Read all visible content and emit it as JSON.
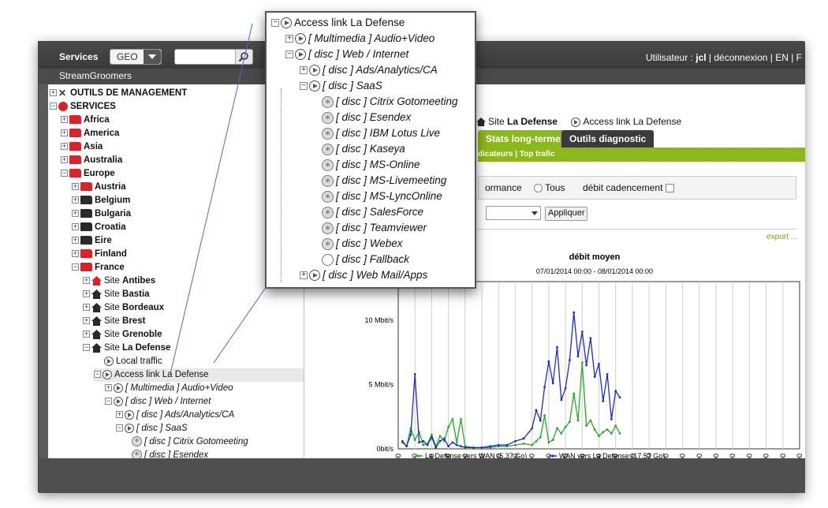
{
  "topbar": {
    "services_label": "Services",
    "geo_value": "GEO",
    "org_name": "StreamGroomers",
    "user_label": "Utilisateur : ",
    "user_name": "jcl",
    "user_links": " | déconnexion | EN | F"
  },
  "sidebar": {
    "items": [
      {
        "label": "OUTILS DE MANAGEMENT"
      },
      {
        "label": "SERVICES"
      },
      {
        "label": "Africa"
      },
      {
        "label": "America"
      },
      {
        "label": "Asia"
      },
      {
        "label": "Australia"
      },
      {
        "label": "Europe"
      },
      {
        "label": "Austria"
      },
      {
        "label": "Belgium"
      },
      {
        "label": "Bulgaria"
      },
      {
        "label": "Croatia"
      },
      {
        "label": "Eire"
      },
      {
        "label": "Finland"
      },
      {
        "label": "France"
      },
      {
        "prefix": "Site ",
        "label": "Antibes"
      },
      {
        "prefix": "Site ",
        "label": "Bastia"
      },
      {
        "prefix": "Site ",
        "label": "Bordeaux"
      },
      {
        "prefix": "Site ",
        "label": "Brest"
      },
      {
        "prefix": "Site ",
        "label": "Grenoble"
      },
      {
        "prefix": "Site ",
        "label": "La Defense"
      },
      {
        "label": "Local traffic"
      },
      {
        "label": "Access link La Defense"
      },
      {
        "label": "[ Multimedia ] Audio+Video"
      },
      {
        "label": "[ disc ] Web / Internet"
      },
      {
        "label": "[ disc ] Ads/Analytics/CA"
      },
      {
        "label": "[ disc ] SaaS"
      },
      {
        "label": "[ disc ] Citrix Gotomeeting"
      },
      {
        "label": "[ disc ] Esendex"
      }
    ]
  },
  "zoom": {
    "items": [
      {
        "label": "Access link La Defense"
      },
      {
        "label": "[ Multimedia ] Audio+Video"
      },
      {
        "label": "[ disc ] Web / Internet"
      },
      {
        "label": "[ disc ] Ads/Analytics/CA"
      },
      {
        "label": "[ disc ] SaaS"
      },
      {
        "label": "[ disc ] Citrix Gotomeeting"
      },
      {
        "label": "[ disc ] Esendex"
      },
      {
        "label": "[ disc ] IBM Lotus Live"
      },
      {
        "label": "[ disc ] Kaseya"
      },
      {
        "label": "[ disc ] MS-Online"
      },
      {
        "label": "[ disc ] MS-Livemeeting"
      },
      {
        "label": "[ disc ] MS-LyncOnline"
      },
      {
        "label": "[ disc ] SalesForce"
      },
      {
        "label": "[ disc ] Teamviewer"
      },
      {
        "label": "[ disc ] Webex"
      },
      {
        "label": "[ disc ] Fallback"
      },
      {
        "label": "[ disc ] Web Mail/Apps"
      }
    ]
  },
  "breadcrumb": {
    "site_prefix": "Site ",
    "site_name": "La Defense",
    "link": "Access link La Defense"
  },
  "tabs": [
    "Stats long-terme",
    "Outils diagnostic"
  ],
  "subnav": "dicateurs | Top trafic",
  "filters": {
    "partial_label": "ormance",
    "radio_all": "Tous",
    "checkbox_label": "débit cadencement"
  },
  "apply_label": "Appliquer",
  "export_label": "export ...",
  "chart_data": {
    "type": "line",
    "title": "débit moyen",
    "subtitle": "07/01/2014 00:00 - 08/01/2014 00:00",
    "y_ticks": [
      "0bit/s",
      "5 Mbit/s",
      "10 Mbit/s"
    ],
    "ylim": [
      0,
      13
    ],
    "y_unit": "Mbit/s",
    "x_ticks": [
      "00:00",
      "01:00",
      "02:00",
      "03:00",
      "04:00",
      "05:00",
      "06:00",
      "07:00",
      "08:00",
      "09:00",
      "10:00",
      "11:00",
      "12:00",
      "13:00",
      "14:00",
      "15:00",
      "16:00",
      "17:00",
      "18:00",
      "19:00",
      "20:00",
      "21:00",
      "22:00",
      "23:00",
      "00:00"
    ],
    "xlim": [
      0,
      24
    ],
    "grid": true,
    "legend_position": "bottom",
    "series": [
      {
        "name": "La Defense vers WAN (5,37 Go)",
        "color": "#22aa22",
        "x": [
          0.25,
          0.5,
          0.75,
          1.0,
          1.25,
          1.5,
          1.75,
          2.0,
          2.25,
          2.5,
          2.75,
          3.0,
          3.25,
          3.5,
          3.75,
          4.0,
          4.5,
          5.0,
          5.5,
          6.0,
          6.5,
          7.0,
          7.5,
          8.0,
          8.25,
          8.5,
          8.75,
          9.0,
          9.25,
          9.5,
          9.75,
          10.0,
          10.25,
          10.5,
          10.75,
          11.0,
          11.25,
          11.5,
          11.75,
          12.0,
          12.25,
          12.5,
          12.75,
          13.0,
          13.25
        ],
        "y": [
          0.5,
          0.2,
          1.6,
          0.7,
          1.3,
          0.3,
          0.4,
          1.1,
          0.2,
          1.0,
          0.6,
          1.7,
          2.3,
          0.5,
          2.3,
          0.2,
          0.1,
          0.1,
          0.1,
          0.2,
          0.2,
          0.3,
          0.4,
          0.3,
          0.6,
          0.9,
          2.6,
          0.5,
          0.7,
          1.6,
          1.2,
          1.7,
          2.1,
          4.3,
          2.2,
          6.7,
          1.8,
          2.2,
          1.5,
          1.0,
          1.3,
          1.5,
          1.2,
          1.8,
          1.2
        ]
      },
      {
        "name": "WAN vers La Defense (17,57 Go)",
        "color": "#1f2bc8",
        "x": [
          0.25,
          0.5,
          0.75,
          1.0,
          1.25,
          1.5,
          1.75,
          2.0,
          2.25,
          2.5,
          2.75,
          3.0,
          3.25,
          3.5,
          3.75,
          4.0,
          4.5,
          5.0,
          5.5,
          6.0,
          6.5,
          7.0,
          7.5,
          8.0,
          8.25,
          8.5,
          8.75,
          9.0,
          9.25,
          9.5,
          9.75,
          10.0,
          10.25,
          10.5,
          10.75,
          11.0,
          11.25,
          11.5,
          11.75,
          12.0,
          12.25,
          12.5,
          12.75,
          13.0,
          13.25
        ],
        "y": [
          0.6,
          0.2,
          1.1,
          5.8,
          0.5,
          0.6,
          0.3,
          0.9,
          0.1,
          0.6,
          0.8,
          0.2,
          0.5,
          0.3,
          0.2,
          0.1,
          0.1,
          0.1,
          0.2,
          0.3,
          0.3,
          0.6,
          0.8,
          1.6,
          3.0,
          2.2,
          4.8,
          6.8,
          5.1,
          7.9,
          3.8,
          4.7,
          6.9,
          10.6,
          7.2,
          9.1,
          6.5,
          8.6,
          5.6,
          6.6,
          3.7,
          5.8,
          2.3,
          4.5,
          4.0
        ]
      }
    ]
  }
}
